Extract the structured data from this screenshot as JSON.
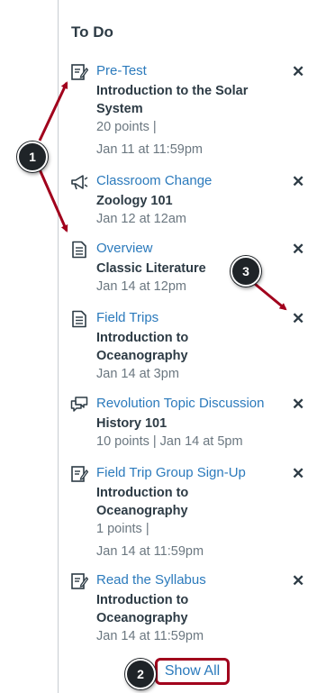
{
  "todo": {
    "title": "To Do",
    "items": [
      {
        "icon": "quiz-icon",
        "title": "Pre-Test",
        "course": "Introduction to the Solar System",
        "meta1": "20 points  |",
        "meta2": "Jan 11 at 11:59pm"
      },
      {
        "icon": "announcement-icon",
        "title": "Classroom Change",
        "course": "Zoology 101",
        "meta1": "Jan 12 at 12am"
      },
      {
        "icon": "page-icon",
        "title": "Overview",
        "course": "Classic Literature",
        "meta1": "Jan 14 at 12pm"
      },
      {
        "icon": "page-icon",
        "title": "Field Trips",
        "course": "Introduction to Oceanography",
        "meta1": "Jan 14 at 3pm"
      },
      {
        "icon": "discussion-icon",
        "title": "Revolution Topic Discussion",
        "course": "History 101",
        "meta1": "10 points  |  Jan 14 at 5pm"
      },
      {
        "icon": "quiz-icon",
        "title": "Field Trip Group Sign-Up",
        "course": "Introduction to Oceanography",
        "meta1": "1 points  |",
        "meta2": "Jan 14 at 11:59pm"
      },
      {
        "icon": "quiz-icon",
        "title": "Read the Syllabus",
        "course": "Introduction to Oceanography",
        "meta1": "Jan 14 at 11:59pm"
      }
    ],
    "dismiss_glyph": "✕",
    "show_all": "Show All"
  },
  "callouts": [
    "1",
    "2",
    "3"
  ],
  "colors": {
    "link": "#2b7abc",
    "text": "#2d3b45",
    "muted": "#6b7780",
    "highlight": "#a1001c",
    "callout": "#1f2428"
  }
}
